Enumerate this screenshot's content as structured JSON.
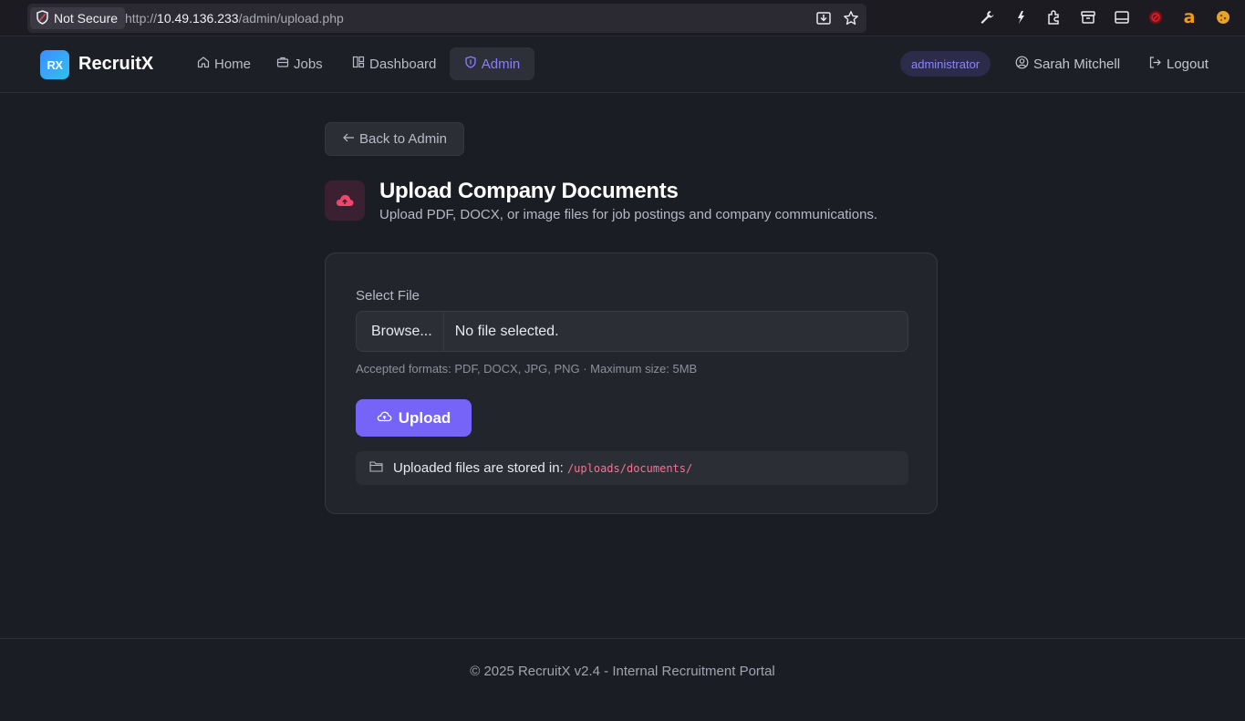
{
  "browser": {
    "security_label": "Not Secure",
    "url_prefix": "http://",
    "url_host": "10.49.136.233",
    "url_path": "/admin/upload.php"
  },
  "nav": {
    "logo_text": "RX",
    "brand": "RecruitX",
    "items": [
      {
        "label": "Home",
        "icon": "home-icon"
      },
      {
        "label": "Jobs",
        "icon": "briefcase-icon"
      },
      {
        "label": "Dashboard",
        "icon": "dashboard-icon"
      },
      {
        "label": "Admin",
        "icon": "shield-icon",
        "active": true
      }
    ],
    "role_badge": "administrator",
    "user_name": "Sarah Mitchell",
    "logout_label": "Logout"
  },
  "page": {
    "back_label": "Back to Admin",
    "title": "Upload Company Documents",
    "subtitle": "Upload PDF, DOCX, or image files for job postings and company communications."
  },
  "form": {
    "field_label": "Select File",
    "browse_label": "Browse...",
    "file_status": "No file selected.",
    "hint": "Accepted formats: PDF, DOCX, JPG, PNG · Maximum size: 5MB",
    "upload_label": "Upload",
    "storage_text": "Uploaded files are stored in:",
    "storage_path": "/uploads/documents/"
  },
  "footer": {
    "text": "© 2025 RecruitX v2.4 - Internal Recruitment Portal"
  },
  "colors": {
    "accent": "#7564f7",
    "background": "#1b1d24",
    "card": "#23252d",
    "path_highlight": "#f57393",
    "upload_icon": "#f0456d"
  }
}
